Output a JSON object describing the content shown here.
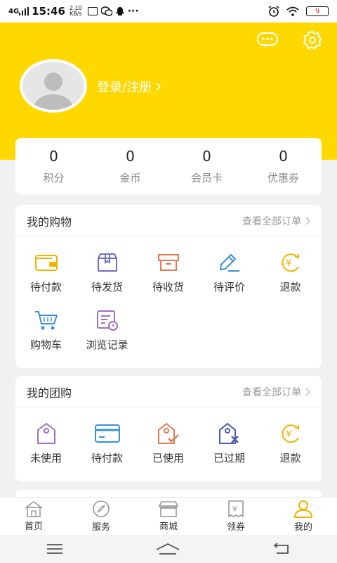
{
  "status": {
    "time": "15:46",
    "signal": "4G",
    "net_speed_value": "2.10",
    "net_speed_unit": "KB/s",
    "battery": "9"
  },
  "colors": {
    "header": "#ffd800",
    "icon_yellow": "#f0b400",
    "icon_purple": "#7070c0",
    "icon_red": "#e07a55",
    "icon_blue": "#3a8fd6"
  },
  "profile": {
    "login_label": "登录/注册"
  },
  "stats": [
    {
      "value": "0",
      "label": "积分"
    },
    {
      "value": "0",
      "label": "金币"
    },
    {
      "value": "0",
      "label": "会员卡"
    },
    {
      "value": "0",
      "label": "优惠券"
    }
  ],
  "shopping": {
    "title": "我的购物",
    "view_all": "查看全部订单",
    "items": [
      {
        "label": "待付款",
        "icon": "wallet-icon"
      },
      {
        "label": "待发货",
        "icon": "package-icon"
      },
      {
        "label": "待收货",
        "icon": "box-icon"
      },
      {
        "label": "待评价",
        "icon": "pen-icon"
      },
      {
        "label": "退款",
        "icon": "refund-icon"
      },
      {
        "label": "购物车",
        "icon": "cart-icon"
      },
      {
        "label": "浏览记录",
        "icon": "history-icon"
      }
    ]
  },
  "group": {
    "title": "我的团购",
    "view_all": "查看全部订单",
    "items": [
      {
        "label": "未使用",
        "icon": "tag-icon"
      },
      {
        "label": "待付款",
        "icon": "card-icon"
      },
      {
        "label": "已使用",
        "icon": "tag-check-icon"
      },
      {
        "label": "已过期",
        "icon": "tag-x-icon"
      },
      {
        "label": "退款",
        "icon": "refund-icon"
      }
    ]
  },
  "tabs": [
    {
      "label": "首页",
      "icon": "home-icon"
    },
    {
      "label": "服务",
      "icon": "compass-icon"
    },
    {
      "label": "商城",
      "icon": "store-icon"
    },
    {
      "label": "领券",
      "icon": "coupon-icon"
    },
    {
      "label": "我的",
      "icon": "user-icon",
      "active": true
    }
  ]
}
